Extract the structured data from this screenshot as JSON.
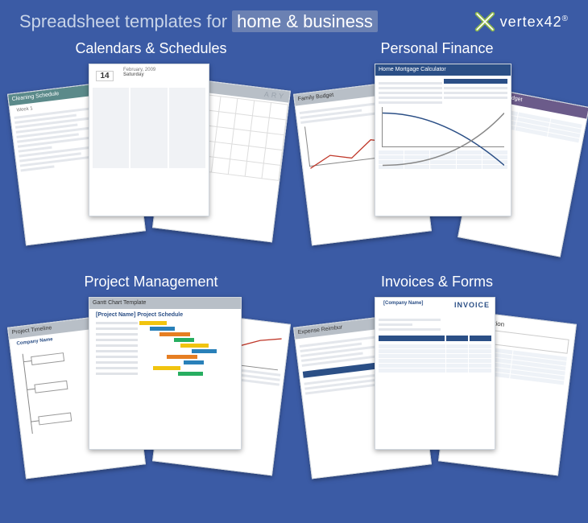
{
  "header": {
    "headline_prefix": "Spreadsheet templates for",
    "headline_highlight": "home & business",
    "logo_text": "vertex42",
    "logo_reg": "®"
  },
  "categories": {
    "calendars": {
      "title": "Calendars & Schedules",
      "sheets": {
        "cleaning": {
          "title": "Cleaning Schedule",
          "sub": "Week 1"
        },
        "planner": {
          "date_num": "14",
          "date_text": "February, 2009",
          "day": "Saturday"
        },
        "calendar": {
          "title": "ARY"
        }
      }
    },
    "finance": {
      "title": "Personal Finance",
      "sheets": {
        "budget": {
          "title": "Family Budget"
        },
        "mortgage": {
          "title": "Home Mortgage Calculator"
        },
        "wedding": {
          "title": "dding Budget"
        }
      }
    },
    "project": {
      "title": "Project Management",
      "sheets": {
        "timeline": {
          "title": "Project Timeline",
          "sub": "Company Name"
        },
        "gantt": {
          "title": "Gantt Chart Template",
          "sub": "[Project Name] Project Schedule"
        },
        "other": {
          "title": ""
        }
      }
    },
    "invoices": {
      "title": "Invoices & Forms",
      "sheets": {
        "expense": {
          "title": "Expense Reimbur"
        },
        "invoice": {
          "title": "INVOICE",
          "company": "[Company Name]"
        },
        "job": {
          "title": "Job Application"
        }
      }
    }
  }
}
